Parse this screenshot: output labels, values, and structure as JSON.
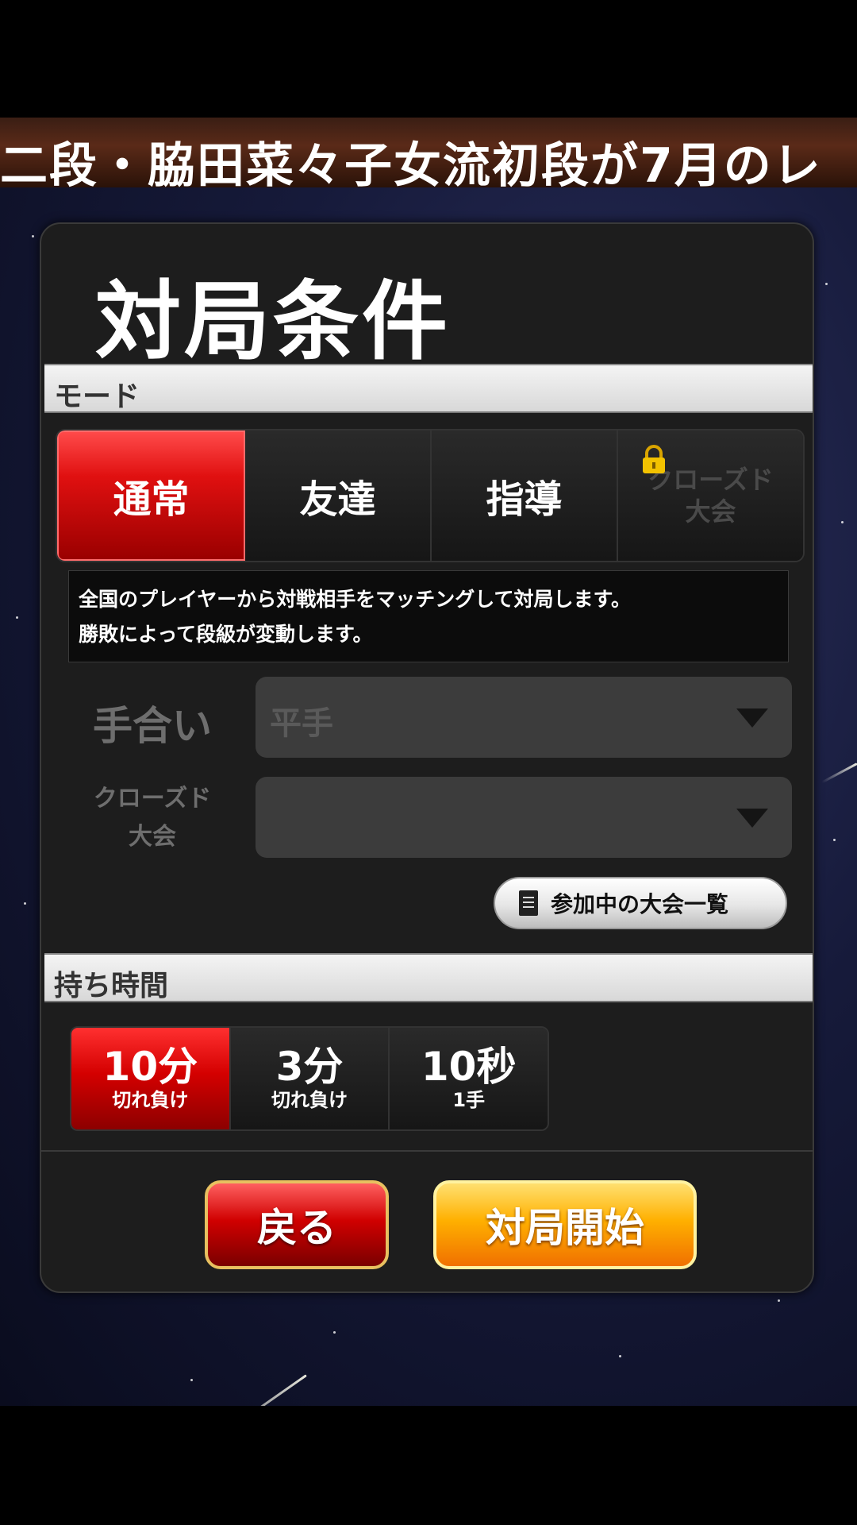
{
  "ticker": {
    "text": "二段・脇田菜々子女流初段が7月のレ"
  },
  "panel": {
    "title": "対局条件"
  },
  "mode_section": {
    "header": "モード"
  },
  "modes": [
    {
      "label": "通常",
      "active": true,
      "locked": false
    },
    {
      "label": "友達",
      "active": false,
      "locked": false
    },
    {
      "label": "指導",
      "active": false,
      "locked": false
    },
    {
      "label_line1": "クローズド",
      "label_line2": "大会",
      "active": false,
      "locked": true,
      "icon": "lock-icon"
    }
  ],
  "description": {
    "line1": "全国のプレイヤーから対戦相手をマッチングして対局します。",
    "line2": "勝敗によって段級が変動します。"
  },
  "handicap": {
    "label": "手合い",
    "value": "平手"
  },
  "closed_tournament": {
    "label_line1": "クローズド",
    "label_line2": "大会",
    "value": ""
  },
  "tournament_list_button": {
    "label": "参加中の大会一覧",
    "icon": "document-icon"
  },
  "time_section": {
    "header": "持ち時間"
  },
  "time_options": [
    {
      "main": "10分",
      "sub": "切れ負け",
      "active": true
    },
    {
      "main": "3分",
      "sub": "切れ負け",
      "active": false
    },
    {
      "main": "10秒",
      "sub": "1手",
      "active": false
    }
  ],
  "actions": {
    "back": "戻る",
    "start": "対局開始"
  },
  "colors": {
    "accent_red": "#d40000",
    "accent_orange": "#ffb000",
    "panel_bg": "#1d1d1d"
  }
}
